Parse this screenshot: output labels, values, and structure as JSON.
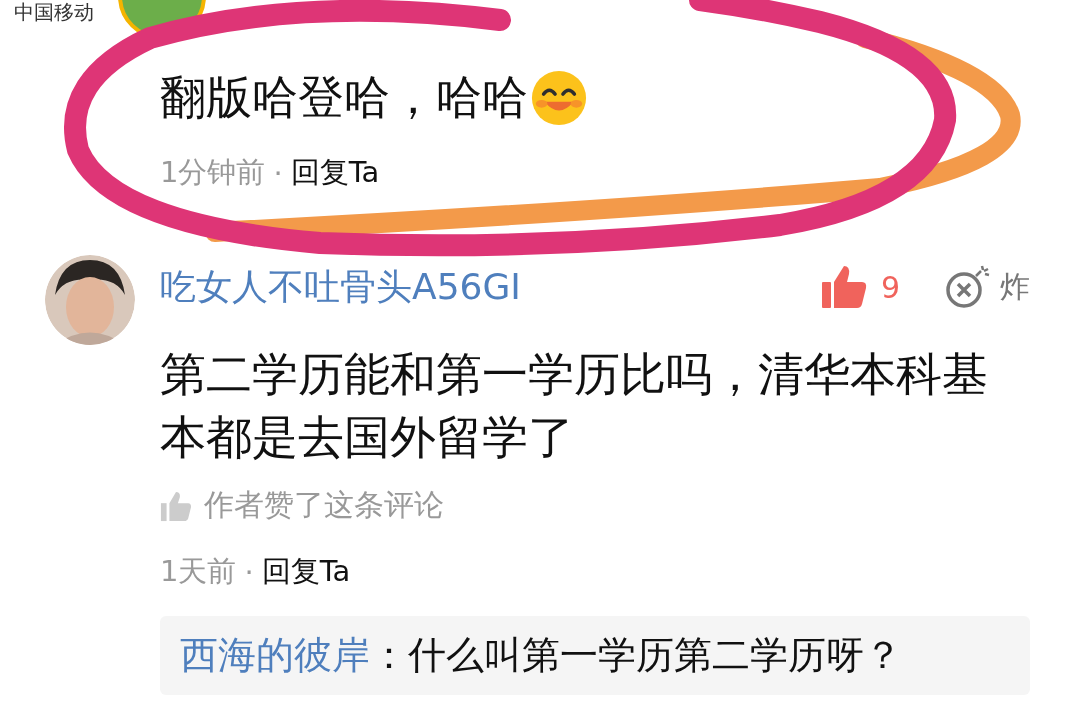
{
  "status_bar": {
    "carrier": "中国移动"
  },
  "comments": [
    {
      "text": "翻版哈登哈，哈哈",
      "emoji": true,
      "time": "1分钟前",
      "dot": "·",
      "reply": "回复Ta"
    },
    {
      "username": "吃女人不吐骨头A56GI",
      "likes": "9",
      "liked": true,
      "bomb": "炸",
      "text": "第二学历能和第一学历比吗，清华本科基本都是去国外留学了",
      "author_liked": "作者赞了这条评论",
      "time": "1天前",
      "dot": "·",
      "reply": "回复Ta",
      "replies": [
        {
          "username": "西海的彼岸",
          "text": "：什么叫第一学历第二学历呀？"
        }
      ]
    }
  ]
}
